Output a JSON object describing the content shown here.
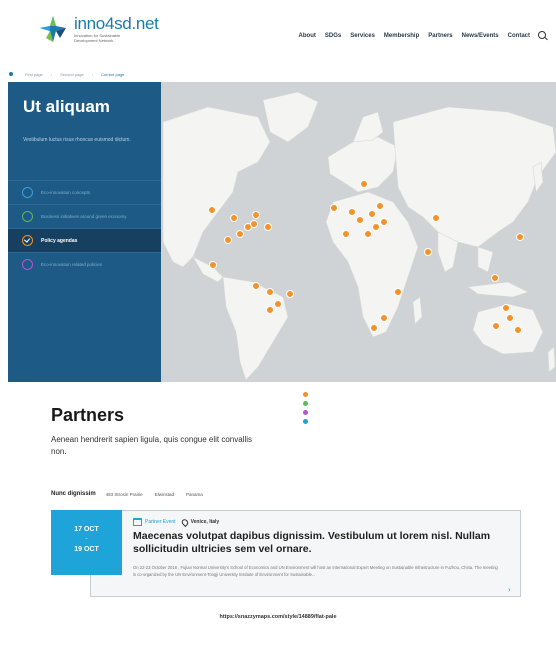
{
  "header": {
    "logo_name": "inno4sd.net",
    "logo_sub": "Innovation for Sustainable Development Network",
    "nav": [
      "About",
      "SDGs",
      "Services",
      "Membership",
      "Partners",
      "News/Events",
      "Contact"
    ]
  },
  "breadcrumb": [
    "First page",
    "Second page",
    "Current page"
  ],
  "sidebar": {
    "title": "Ut aliquam",
    "description": "Vestibulum luctus risus rhoncus euismod dictum.",
    "items": [
      {
        "label": "Eco-innovation concepts",
        "color": "#3aa0dc",
        "active": false
      },
      {
        "label": "Business initiatives around green economy",
        "color": "#5cb85c",
        "active": false
      },
      {
        "label": "Policy agendas",
        "color": "#f0932b",
        "active": true
      },
      {
        "label": "Eco-innovation related policies",
        "color": "#b455d6",
        "active": false
      }
    ]
  },
  "map": {
    "marker_color": "#f0932b",
    "land_color": "#f4f4f2",
    "water_color": "#cfd3d6"
  },
  "indicator_dots": [
    "#f0932b",
    "#5cb85c",
    "#b455d6",
    "#1ea4d8"
  ],
  "partners": {
    "title": "Partners",
    "description": "Aenean hendrerit sapien ligula, quis congue elit convallis non."
  },
  "filters": [
    "Nunc dignissim",
    "483 Strosin Prairie",
    "Elwinstad",
    "Panama"
  ],
  "event": {
    "date_start": "17 OCT",
    "date_sep": "-",
    "date_end": "19 OCT",
    "type": "Partner Event",
    "place": "Venice, Italy",
    "title": "Maecenas volutpat dapibus dignissim. Vestibulum ut lorem nisl. Nullam sollicitudin ultricies sem vel ornare.",
    "body": "On 22-23 October 2018 , Fujian Normal University's School of Economics and UN Environment will host an International Expert Meeting on Sustainable Infrastructure in Fuzhou, China. The meeting is co-organized by the UN Environment-Tongji University Institute of Environment for Sustainable..."
  },
  "footer_url": "https://snazzymaps.com/style/14889/flat-pale"
}
